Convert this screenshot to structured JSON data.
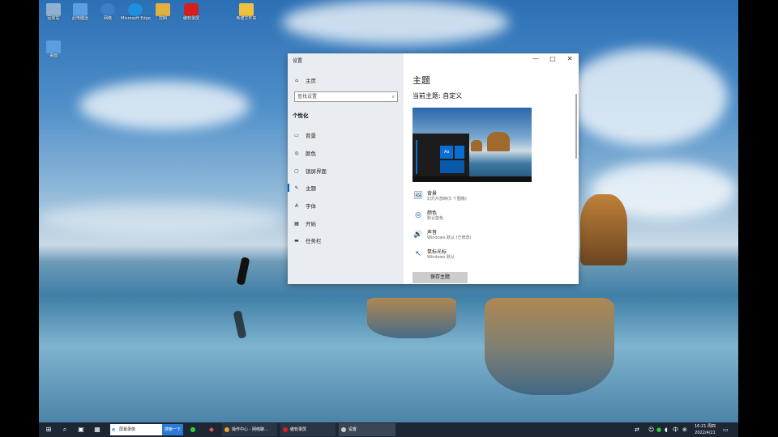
{
  "desktop": {
    "icons": [
      {
        "label": "回收站",
        "color": "#8fb0d0"
      },
      {
        "label": "此电脑远",
        "color": "#5aa0e0"
      },
      {
        "label": "网络",
        "color": "#3a7fc8"
      },
      {
        "label": "Microsoft Edge",
        "color": "#1f8fe0"
      },
      {
        "label": "控制",
        "color": "#e0b040"
      },
      {
        "label": "傲软录屏",
        "color": "#d42020"
      },
      {
        "label": "新建文件夹",
        "color": "#f0c040"
      },
      {
        "label": "桌面",
        "color": "#5aa0e0"
      }
    ]
  },
  "settings": {
    "window_title": "设置",
    "controls": {
      "minimize": "—",
      "maximize": "□",
      "close": "✕"
    },
    "nav": {
      "home_label": "主页",
      "search_placeholder": "查找设置",
      "section_heading": "个性化",
      "items": [
        {
          "label": "背景",
          "icon": "image-icon",
          "glyph": "▭"
        },
        {
          "label": "颜色",
          "icon": "palette-icon",
          "glyph": "◎"
        },
        {
          "label": "锁屏界面",
          "icon": "lock-screen-icon",
          "glyph": "▢"
        },
        {
          "label": "主题",
          "icon": "theme-icon",
          "glyph": "✎",
          "active": true
        },
        {
          "label": "字体",
          "icon": "font-icon",
          "glyph": "A"
        },
        {
          "label": "开始",
          "icon": "start-icon",
          "glyph": "▦"
        },
        {
          "label": "任务栏",
          "icon": "taskbar-icon",
          "glyph": "▬"
        }
      ]
    },
    "content": {
      "title": "主题",
      "current_theme": "当前主题: 自定义",
      "preview_label": "Aa",
      "options": [
        {
          "title": "背景",
          "subtitle": "幻灯片放映(5 个图像)",
          "icon": "background-icon",
          "glyph": "🖼"
        },
        {
          "title": "颜色",
          "subtitle": "默认蓝色",
          "icon": "color-icon",
          "glyph": "◎"
        },
        {
          "title": "声音",
          "subtitle": "Windows 默认 (已修改)",
          "icon": "sound-icon",
          "glyph": "🔊"
        },
        {
          "title": "鼠标光标",
          "subtitle": "Windows 默认",
          "icon": "cursor-icon",
          "glyph": "↖"
        }
      ],
      "save_button": "保存主题"
    }
  },
  "taskbar": {
    "search_text": "屏幕录像",
    "search_button": "搜索一下",
    "apps": [
      {
        "label": "操作中心 - 网络聊...",
        "color": "#e8a030"
      },
      {
        "label": "傲软录屏",
        "color": "#d42020"
      },
      {
        "label": "设置",
        "color": "#cccccc"
      }
    ],
    "clock_time": "16:21 周四",
    "clock_date": "2022/4/21"
  }
}
